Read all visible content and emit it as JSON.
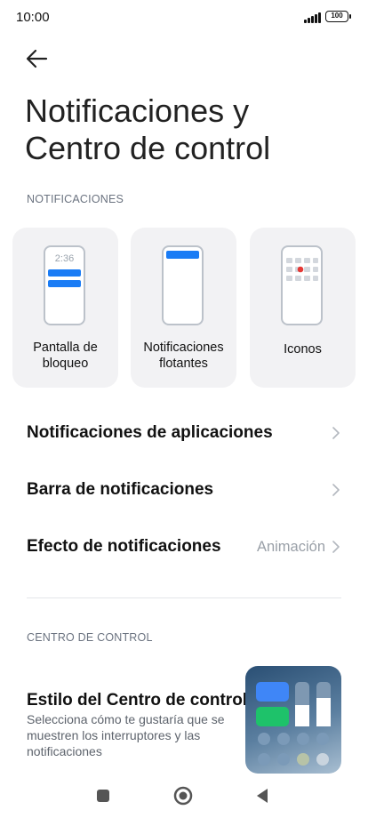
{
  "status_bar": {
    "time": "10:00",
    "battery": "100"
  },
  "page": {
    "title": "Notificaciones y Centro de control"
  },
  "notifications_section": {
    "label": "NOTIFICACIONES",
    "cards": [
      {
        "label": "Pantalla de bloqueo",
        "preview_time": "2:36"
      },
      {
        "label": "Notificaciones flotantes"
      },
      {
        "label": "Iconos"
      }
    ],
    "rows": [
      {
        "label": "Notificaciones de aplicaciones",
        "value": ""
      },
      {
        "label": "Barra de notificaciones",
        "value": ""
      },
      {
        "label": "Efecto de notificaciones",
        "value": "Animación"
      }
    ]
  },
  "control_section": {
    "label": "CENTRO DE CONTROL",
    "style_item": {
      "title": "Estilo del Centro de control",
      "description": "Selecciona cómo te gustaría que se muestren los interruptores y las notificaciones"
    }
  },
  "colors": {
    "accent": "#1a7cf5",
    "notification_dot": "#e53935",
    "toggle_green": "#1ec26a"
  },
  "icons": {
    "back": "arrow-left-icon",
    "chevron": "chevron-right-icon",
    "recents": "square-icon",
    "home": "circle-icon",
    "back_nav": "triangle-left-icon"
  }
}
